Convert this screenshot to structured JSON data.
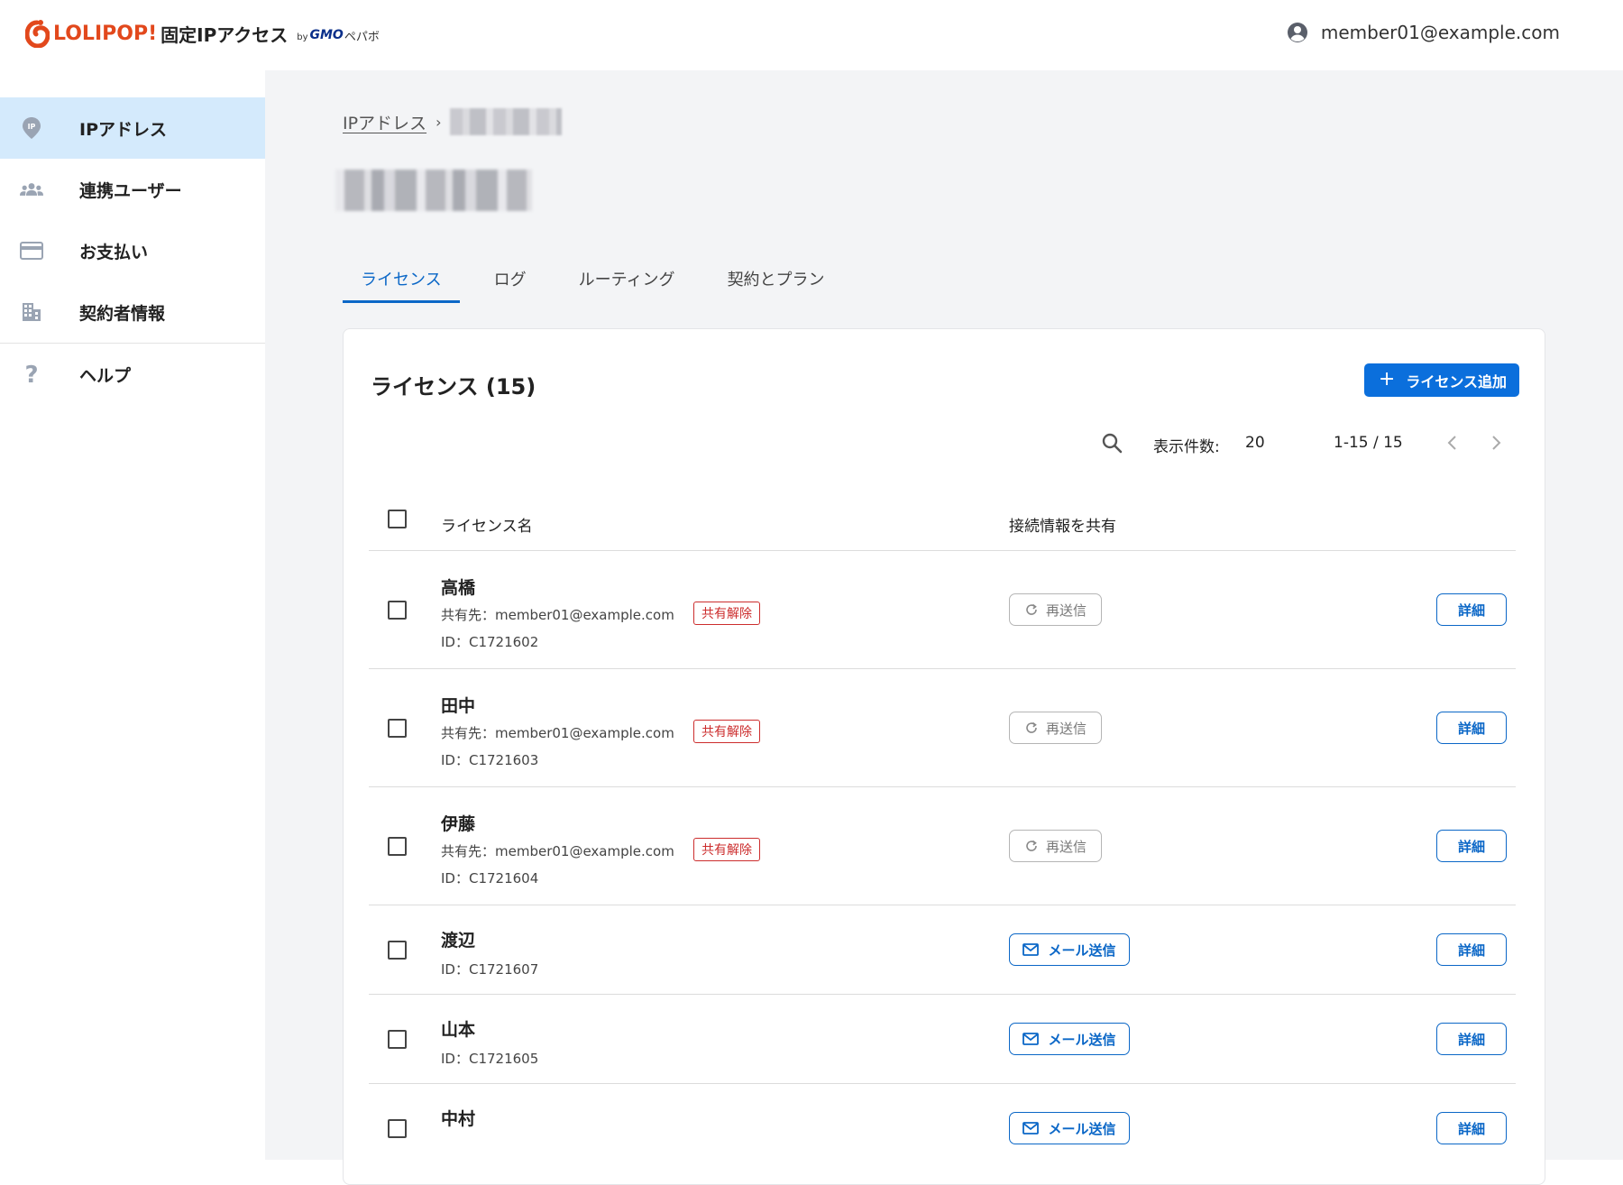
{
  "header": {
    "logo": {
      "brand": "LOLIPOP!",
      "product": "固定IPアクセス",
      "by": "by",
      "gmo": "GMO",
      "pepabo": "ペパボ"
    },
    "user_email": "member01@example.com"
  },
  "sidebar": {
    "items": [
      {
        "label": "IPアドレス",
        "icon": "location-pin-icon",
        "active": true
      },
      {
        "label": "連携ユーザー",
        "icon": "users-icon",
        "active": false
      },
      {
        "label": "お支払い",
        "icon": "credit-card-icon",
        "active": false
      },
      {
        "label": "契約者情報",
        "icon": "building-icon",
        "active": false
      },
      {
        "label": "ヘルプ",
        "icon": "question-icon",
        "active": false
      }
    ]
  },
  "breadcrumb": {
    "root": "IPアドレス",
    "separator": "›"
  },
  "tabs": [
    {
      "label": "ライセンス",
      "active": true
    },
    {
      "label": "ログ",
      "active": false
    },
    {
      "label": "ルーティング",
      "active": false
    },
    {
      "label": "契約とプラン",
      "active": false
    }
  ],
  "license_card": {
    "title": "ライセンス (15)",
    "add_button": {
      "icon": "plus-icon",
      "label": "ライセンス追加"
    },
    "toolbar": {
      "per_page_label": "表示件数:",
      "per_page_value": "20",
      "range": "1-15 / 15"
    },
    "columns": {
      "name": "ライセンス名",
      "share": "接続情報を共有"
    },
    "rows": [
      {
        "name": "高橋",
        "shared_with": "共有先：member01@example.com",
        "id": "ID：C1721602",
        "badge": "共有解除",
        "action": "再送信",
        "action_type": "resend",
        "detail": "詳細"
      },
      {
        "name": "田中",
        "shared_with": "共有先：member01@example.com",
        "id": "ID：C1721603",
        "badge": "共有解除",
        "action": "再送信",
        "action_type": "resend",
        "detail": "詳細"
      },
      {
        "name": "伊藤",
        "shared_with": "共有先：member01@example.com",
        "id": "ID：C1721604",
        "badge": "共有解除",
        "action": "再送信",
        "action_type": "resend",
        "detail": "詳細"
      },
      {
        "name": "渡辺",
        "id": "ID：C1721607",
        "action": "メール送信",
        "action_type": "mail",
        "detail": "詳細"
      },
      {
        "name": "山本",
        "id": "ID：C1721605",
        "action": "メール送信",
        "action_type": "mail",
        "detail": "詳細"
      },
      {
        "name": "中村",
        "action": "メール送信",
        "action_type": "mail",
        "detail": "詳細"
      }
    ]
  },
  "colors": {
    "accent": "#0b67c7",
    "primary_button": "#0b6fdc",
    "brand": "#e2481c",
    "danger": "#cc2d2d",
    "sidebar_active": "#d4eafc",
    "main_bg": "#f3f4f6"
  }
}
